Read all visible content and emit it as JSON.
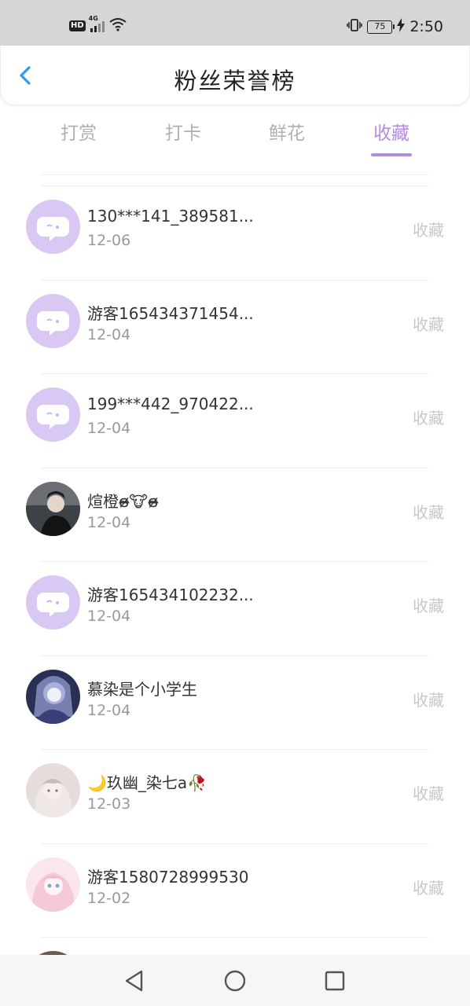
{
  "status_bar": {
    "hd": "HD",
    "network": "4G",
    "battery": "75",
    "time": "2:50"
  },
  "header": {
    "title": "粉丝荣誉榜"
  },
  "tabs": [
    {
      "label": "打赏",
      "active": false
    },
    {
      "label": "打卡",
      "active": false
    },
    {
      "label": "鲜花",
      "active": false
    },
    {
      "label": "收藏",
      "active": true
    }
  ],
  "fans": [
    {
      "name": "130***141_389581...",
      "date": "12-06",
      "action": "收藏",
      "avatar": "default-chat-avatar"
    },
    {
      "name": "游客165434371454...",
      "date": "12-04",
      "action": "收藏",
      "avatar": "default-chat-avatar"
    },
    {
      "name": "199***442_970422...",
      "date": "12-04",
      "action": "收藏",
      "avatar": "default-chat-avatar"
    },
    {
      "name": "煊橙ɞ̴̶̷🐮ɞ̴̶̷",
      "date": "12-04",
      "action": "收藏",
      "avatar": "photo-dark-boy"
    },
    {
      "name": "游客165434102232...",
      "date": "12-04",
      "action": "收藏",
      "avatar": "default-chat-avatar"
    },
    {
      "name": "慕染是个小学生",
      "date": "12-04",
      "action": "收藏",
      "avatar": "photo-blue-anime"
    },
    {
      "name": "🌙玖幽_染七a🥀",
      "date": "12-03",
      "action": "收藏",
      "avatar": "photo-pale-anime"
    },
    {
      "name": "游客1580728999530",
      "date": "12-02",
      "action": "收藏",
      "avatar": "photo-pink-anime"
    }
  ],
  "colors": {
    "accent": "#b48ce0",
    "back_arrow": "#2d9cf0",
    "avatar_default_bg": "#d9c8f3"
  }
}
